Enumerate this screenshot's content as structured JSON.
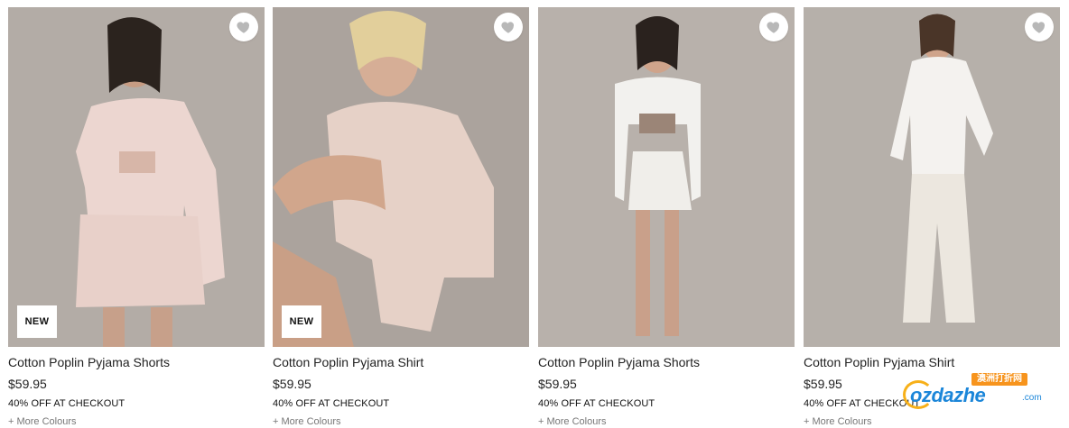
{
  "products": [
    {
      "name": "Cotton Poplin Pyjama Shorts",
      "price": "$59.95",
      "promo": "40% OFF AT CHECKOUT",
      "more": "+ More Colours",
      "badge": "NEW",
      "image_description": "model wearing pink striped shirt and shorts"
    },
    {
      "name": "Cotton Poplin Pyjama Shirt",
      "price": "$59.95",
      "promo": "40% OFF AT CHECKOUT",
      "more": "+ More Colours",
      "badge": "NEW",
      "image_description": "seated model wearing pink poplin shirt"
    },
    {
      "name": "Cotton Poplin Pyjama Shorts",
      "price": "$59.95",
      "promo": "40% OFF AT CHECKOUT",
      "more": "+ More Colours",
      "badge": "",
      "image_description": "model wearing white shirt and shorts"
    },
    {
      "name": "Cotton Poplin Pyjama Shirt",
      "price": "$59.95",
      "promo": "40% OFF AT CHECKOUT",
      "more": "+ More Colours",
      "badge": "",
      "image_description": "model wearing white shirt and cream trousers"
    }
  ],
  "icons": {
    "wishlist": "heart-icon"
  },
  "watermark": {
    "top": "澳洲打折网",
    "main": "ozdazhe",
    "suffix": ".com"
  },
  "colors": {
    "badge_bg": "#ffffff",
    "wishlist_icon": "#b8b8b8",
    "watermark_blue": "#1b86d9",
    "watermark_orange": "#f7941d"
  }
}
